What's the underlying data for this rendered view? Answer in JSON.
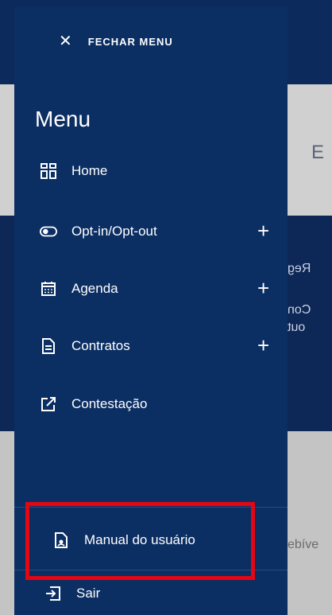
{
  "background": {
    "partial_texts": {
      "t1": "E",
      "t2": "Reg",
      "t3": "Con",
      "t4": "out",
      "t5": "ebíve"
    }
  },
  "drawer": {
    "close_label": "FECHAR MENU",
    "menu_title": "Menu",
    "items": [
      {
        "label": "Home",
        "icon": "grid-icon",
        "expandable": false
      },
      {
        "label": "Opt-in/Opt-out",
        "icon": "toggle-icon",
        "expandable": true
      },
      {
        "label": "Agenda",
        "icon": "calendar-icon",
        "expandable": true
      },
      {
        "label": "Contratos",
        "icon": "document-icon",
        "expandable": true
      },
      {
        "label": "Contestação",
        "icon": "external-link-icon",
        "expandable": false
      }
    ],
    "footer_items": [
      {
        "label": "Manual do usuário",
        "icon": "manual-icon"
      },
      {
        "label": "Sair",
        "icon": "logout-icon"
      }
    ],
    "expand_symbol": "+",
    "close_symbol": "✕"
  },
  "colors": {
    "drawer": "#0b2e63",
    "highlight": "#e30613"
  }
}
